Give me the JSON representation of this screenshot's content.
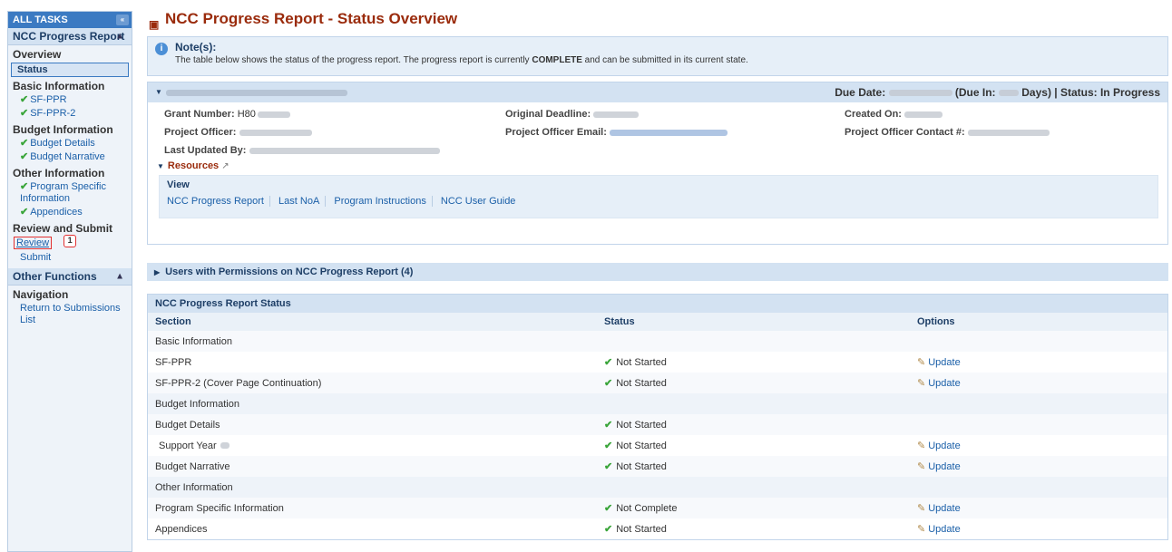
{
  "sidebar": {
    "all_tasks": "ALL TASKS",
    "collapse_icon": "«",
    "ncc_progress_report": "NCC Progress Report",
    "overview": "Overview",
    "status": "Status",
    "basic_information": "Basic Information",
    "sf_ppr": "SF-PPR",
    "sf_ppr_2": "SF-PPR-2",
    "budget_information": "Budget Information",
    "budget_details": "Budget Details",
    "budget_narrative": "Budget Narrative",
    "other_information": "Other Information",
    "program_specific": "Program Specific Information",
    "appendices": "Appendices",
    "review_and_submit": "Review and Submit",
    "review": "Review",
    "callout_number": "1",
    "submit": "Submit",
    "other_functions": "Other Functions",
    "navigation": "Navigation",
    "return_to_list": "Return to Submissions List"
  },
  "header": {
    "title": "NCC Progress Report - Status Overview"
  },
  "note": {
    "title": "Note(s):",
    "text_before": "The table below shows the status of the progress report. The progress report is currently ",
    "text_bold": "COMPLETE",
    "text_after": " and can be submitted in its current state."
  },
  "tracking": {
    "due_label": "Due Date:",
    "due_in_label": "(Due In:",
    "days_label": "Days) | Status: In Progress",
    "grant_number_label": "Grant Number:",
    "grant_number_value": "H80",
    "project_officer_label": "Project Officer:",
    "last_updated_label": "Last Updated By:",
    "original_deadline_label": "Original Deadline:",
    "po_email_label": "Project Officer Email:",
    "created_on_label": "Created On:",
    "po_contact_label": "Project Officer Contact #:"
  },
  "resources": {
    "title": "Resources",
    "view": "View",
    "links": [
      "NCC Progress Report",
      "Last NoA",
      "Program Instructions",
      "NCC User Guide"
    ]
  },
  "users_bar": "Users with Permissions on NCC Progress Report (4)",
  "status_table": {
    "title": "NCC Progress Report Status",
    "headers": [
      "Section",
      "Status",
      "Options"
    ],
    "update_label": "Update",
    "rows": [
      {
        "section": "Basic Information",
        "status": "",
        "option": "",
        "group": true
      },
      {
        "section": "SF-PPR",
        "status": "Not Started",
        "option": "Update"
      },
      {
        "section": "SF-PPR-2 (Cover Page Continuation)",
        "status": "Not Started",
        "option": "Update"
      },
      {
        "section": "Budget Information",
        "status": "",
        "option": "",
        "group": true
      },
      {
        "section": "Budget Details",
        "status": "Not Started",
        "option": ""
      },
      {
        "section": "Support Year",
        "status": "Not Started",
        "option": "Update",
        "indent": true
      },
      {
        "section": "Budget Narrative",
        "status": "Not Started",
        "option": "Update"
      },
      {
        "section": "Other Information",
        "status": "",
        "option": "",
        "group": true
      },
      {
        "section": "Program Specific Information",
        "status": "Not Complete",
        "option": "Update"
      },
      {
        "section": "Appendices",
        "status": "Not Started",
        "option": "Update"
      }
    ]
  }
}
